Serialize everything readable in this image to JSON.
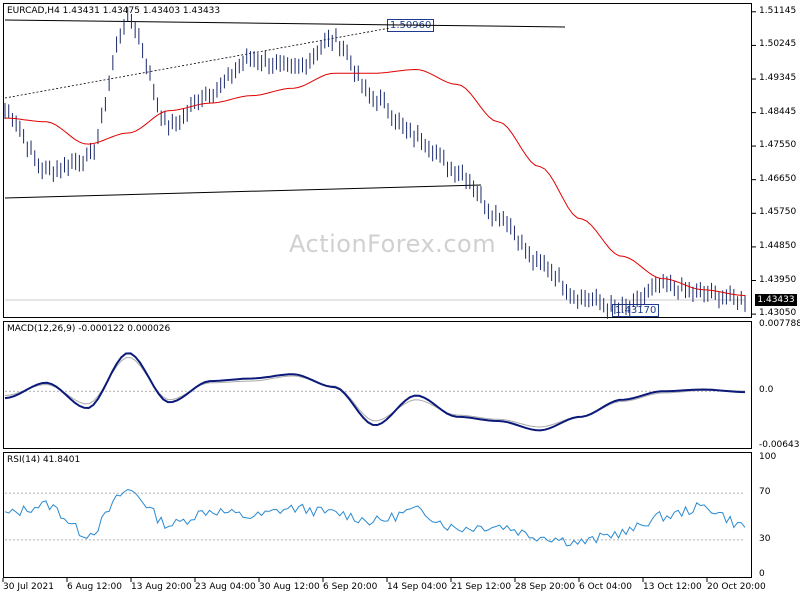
{
  "price_panel": {
    "title": "EURCAD,H4  1.43431 1.43475 1.43403 1.43433",
    "current_price": "1.43433",
    "watermark": "ActionForex.com",
    "callout_high": "1.50960",
    "callout_low": "1.43170",
    "ticks": [
      "1.51145",
      "1.50245",
      "1.49345",
      "1.48445",
      "1.47550",
      "1.46650",
      "1.45750",
      "1.44850",
      "1.43950",
      "1.43050"
    ]
  },
  "macd_panel": {
    "title": "MACD(12,26,9) -0.000122 0.000026",
    "ticks": [
      "0.007788",
      "0.0",
      "-0.006437"
    ]
  },
  "rsi_panel": {
    "title": "RSI(14) 41.8401",
    "ticks": [
      "100",
      "70",
      "30",
      "0"
    ]
  },
  "x_axis": {
    "ticks": [
      "30 Jul 2021",
      "6 Aug 12:00",
      "13 Aug 20:00",
      "23 Aug 04:00",
      "30 Aug 12:00",
      "6 Sep 20:00",
      "14 Sep 04:00",
      "21 Sep 12:00",
      "28 Sep 20:00",
      "6 Oct 04:00",
      "13 Oct 12:00",
      "20 Oct 20:00"
    ]
  },
  "chart_data": [
    {
      "type": "line",
      "title": "EURCAD,H4  1.43431 1.43475 1.43403 1.43433",
      "ylim": [
        1.43,
        1.513
      ],
      "x": [
        "30 Jul 2021",
        "6 Aug 12:00",
        "13 Aug 20:00",
        "23 Aug 04:00",
        "30 Aug 12:00",
        "6 Sep 20:00",
        "14 Sep 04:00",
        "21 Sep 12:00",
        "28 Sep 20:00",
        "6 Oct 04:00",
        "13 Oct 12:00",
        "20 Oct 20:00"
      ],
      "series": [
        {
          "values": [
            1.485,
            1.469,
            1.472,
            1.5095,
            1.481,
            1.49,
            1.499,
            1.496,
            1.504,
            1.488,
            1.478,
            1.469,
            1.457,
            1.444,
            1.435,
            1.4317,
            1.438,
            1.436,
            1.4343
          ]
        },
        {
          "values": [
            1.483,
            1.482,
            1.476,
            1.479,
            1.485,
            1.487,
            1.489,
            1.491,
            1.495,
            1.495,
            1.496,
            1.492,
            1.482,
            1.47,
            1.456,
            1.446,
            1.44,
            1.437,
            1.4355
          ]
        }
      ]
    },
    {
      "type": "line",
      "title": "MACD(12,26,9) -0.000122 0.000026",
      "ylim": [
        -0.006437,
        0.007788
      ],
      "series": [
        {
          "values": [
            -0.0008,
            0.001,
            -0.002,
            0.0045,
            -0.0013,
            0.0012,
            0.0015,
            0.002,
            0.0005,
            -0.004,
            -0.0005,
            -0.003,
            -0.0035,
            -0.0046,
            -0.003,
            -0.001,
            0.0,
            0.0002,
            -0.0001
          ]
        },
        {
          "values": [
            -0.0005,
            0.0008,
            -0.0015,
            0.004,
            -0.001,
            0.001,
            0.0012,
            0.0018,
            0.0006,
            -0.0035,
            -0.001,
            -0.0028,
            -0.0033,
            -0.0042,
            -0.003,
            -0.0012,
            -0.0002,
            0.0001,
            3e-05
          ]
        }
      ]
    },
    {
      "type": "line",
      "title": "RSI(14) 41.8401",
      "ylim": [
        0,
        100
      ],
      "series": [
        {
          "values": [
            52,
            60,
            35,
            72,
            43,
            55,
            50,
            57,
            53,
            46,
            55,
            40,
            42,
            33,
            28,
            36,
            50,
            58,
            41.8
          ]
        }
      ]
    }
  ]
}
